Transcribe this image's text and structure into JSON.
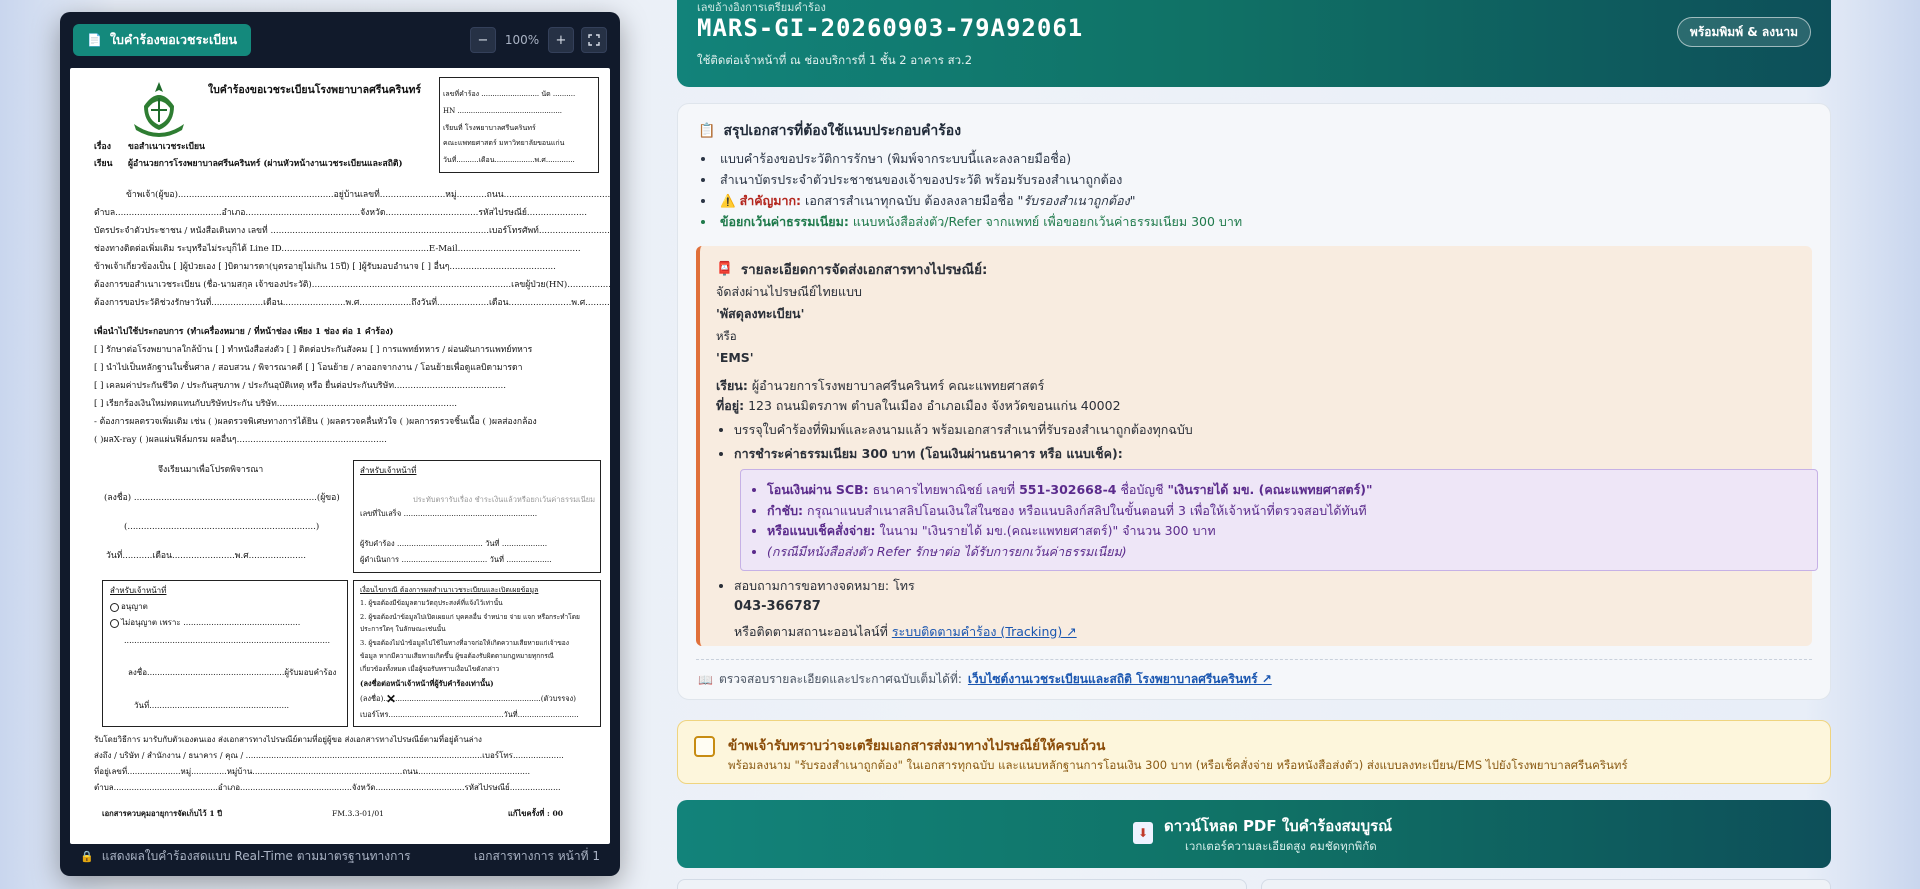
{
  "viewer": {
    "badge_label": "ใบคำร้องขอเวชระเบียน",
    "zoom_minus": "−",
    "zoom_value": "100%",
    "zoom_plus": "+",
    "fullscreen": "⛶",
    "footer_left": "แสดงผลใบคำร้องสดแบบ Real-Time ตามมาตรฐานทางการ",
    "footer_right": "เอกสารทางการ หน้าที่ 1"
  },
  "form": {
    "title": "ใบคำร้องขอเวชระเบียนโรงพยาบาลศรีนครินทร์",
    "subject_label": "เรื่อง",
    "subject": "ขอสำเนาเวชระเบียน",
    "to_label": "เรียน",
    "to": "ผู้อำนวยการโรงพยาบาลศรีนครินทร์ (ผ่านหัวหน้างานเวชระเบียนและสถิติ)",
    "box_line1": "เลขที่คำร้อง .......................... นัด ..........",
    "box_line2": "HN ...............................................",
    "box_line3": "เรียนที่  โรงพยาบาลศรีนครินทร์",
    "box_line4": "คณะแพทยศาสตร์ มหาวิทยาลัยขอนแก่น",
    "box_line5": "วันที่..........เดือน..................พ.ศ.............",
    "line1": "ข้าพเจ้า(ผู้ขอ).........................................................อยู่บ้านเลขที่........................หมู่...........ถนน.......................................",
    "line2": "ตำบล.......................................อำเภอ..........................................จังหวัด..................................รหัสไปรษณีย์......................",
    "line3": "บัตรประจำตัวประชาชน / หนังสือเดินทาง เลขที่ ................................................................................เบอร์โทรศัพท์..........................",
    "line4": "ช่องทางติดต่อเพิ่มเติม ระบุหรือไม่ระบุก็ได้ Line ID......................................................E-Mail.............................................",
    "line5": "ข้าพเจ้าเกี่ยวข้องเป็น [  ]ผู้ป่วยเอง [  ]บิดามารดา(บุตรอายุไม่เกิน 15ปี) [  ]ผู้รับมอบอำนาจ [  ] อื่นๆ.......................................",
    "line6": "ต้องการขอสำเนาเวชระเบียน (ชื่อ-นามสกุล เจ้าของประวัติ).........................................................................เลขผู้ป่วย(HN)......................",
    "line7": "ต้องการขอประวัติช่วงรักษาวันที่...................เดือน.......................พ.ศ...................ถึงวันที่...................เดือน.......................พ.ศ..................",
    "purpose_title": "เพื่อนำไปใช้ประกอบการ (ทำเครื่องหมาย /  ที่หน้าช่อง เพียง 1 ช่อง ต่อ 1 คำร้อง)",
    "purpose1": "[  ] รักษาต่อโรงพยาบาลใกล้บ้าน   [  ] ทำหนังสือส่งตัว   [  ] ติดต่อประกันสังคม   [  ] การแพทย์ทหาร / ผ่อนผันการแพทย์ทหาร",
    "purpose2": "[  ] นำไปเป็นหลักฐานในชั้นศาล / สอบสวน / พิจารณาคดี   [  ] โอนย้าย / ลาออกจากงาน / โอนย้ายเพื่อดูแลบิดามารดา",
    "purpose3": "[  ] เคลมค่าประกันชีวิต / ประกันสุขภาพ / ประกันอุบัติเหตุ หรือ ยื่นต่อประกันบริษัท.........................................",
    "purpose4": "[  ] เรียกร้องเงินใหม่ทดแทนกับบริษัทประกัน บริษัท..................................................................",
    "purpose5": " - ต้องการผลตรวจเพิ่มเติม เช่น (  )ผลตรวจพิเศษทางการได้ยิน (  )ผลตรวจคลื่นหัวใจ (  )ผลการตรวจชิ้นเนื้อ (  )ผลส่องกล้อง",
    "purpose6": "(  )ผลX-ray (  )ผลแผ่นฟิล์มกรม ผลอื่นๆ.......................................................",
    "sign_intro": "จึงเรียนมาเพื่อโปรดพิจารณา",
    "sign_name": "(ลงชื่อ) ...................................................................(ผู้ขอ)",
    "sign_paren": "(.....................................................................)",
    "sign_date": "วันที่...........เดือน.......................พ.ศ.....................",
    "staff_title": "สำหรับเจ้าหน้าที่",
    "staff_note": "ประทับตรารับเรื่อง  ชำระเงินแล้วหรือยกเว้นค่าธรรมเนียม",
    "staff_l1": "เลขที่ใบเสร็จ ........................................................",
    "staff_l2": "ผู้รับคำร้อง .................................... วันที่ ...................",
    "staff_l3": "ผู้ดำเนินการ .................................... วันที่ ...................",
    "officer_title": "สำหรับเจ้าหน้าที่",
    "officer_allow": "อนุญาต",
    "officer_deny": "ไม่อนุญาต เพราะ ..............................................",
    "officer_dots": ".................................................................................",
    "officer_sign": "ลงชื่อ......................................................ผู้รับมอบคำร้อง",
    "officer_date": "วันที่.......................................................",
    "delegate_title": "เงื่อนไขกรณี ต้องการผลสำเนาเวชระเบียนและเปิดเผยข้อมูล",
    "delegate1": "1. ผู้ขอต้องมีข้อมูลตามวัตถุประสงค์ที่แจ้งไว้เท่านั้น",
    "delegate2": "2. ผู้ขอต้องนำข้อมูลไปเปิดเผยแก่ บุคคลอื่น จำหน่าย จ่าย แจก หรือกระทำโดย",
    "delegate2b": "ประการใดๆ ในลักษณะเช่นนั้น",
    "delegate3": "3. ผู้ขอต้องไม่นำข้อมูลไปใช้ในทางที่อาจก่อให้เกิดความเสียหายแก่เจ้าของ",
    "delegate3b": "ข้อมูล หากมีความเสียหายเกิดขึ้น ผู้ขอต้องรับผิดตามกฎหมายทุกกรณี",
    "delegate3c": "เกี่ยวข้องทั้งหมด เมื่อผู้ขอรับทราบเงื่อนไขดังกล่าว",
    "delegate_sign_title": "(ลงชื่อต่อหน้าเจ้าหน้าที่ผู้รับคำร้องเท่านั้น)",
    "delegate_sign": "(ลงชื่อ)...................................................................(ตัวบรรจง)",
    "delegate_phone": "เบอร์โทร.................................................วันที่..........................",
    "receive_line": "รับโดยวิธีการ        มารับกับตัวเองตนเอง       ส่งเอกสารทางไปรษณีย์ตามที่อยู่ผู้ขอ        ส่งเอกสารทางไปรษณีย์ตามที่อยู่ด้านล่าง",
    "addr1": "ส่งถึง / บริษัท / สำนักงาน / ธนาคาร / คุณ / .............................................................................................เบอร์โทร....................",
    "addr2": "ที่อยู่เลขที่.....................หมู่..............หมู่บ้าน...........................................................ถนน............................................",
    "addr3": "ตำบล.........................................อำเภอ............................................จังหวัด...................................รหัสไปรษณีย์....................",
    "footer_left": "เอกสารควบคุมอายุการจัดเก็บไว้ 1 ปี",
    "footer_mid": "FM.3.3-01/01",
    "footer_right": "แก้ไขครั้งที่ : 00"
  },
  "hero": {
    "top_label": "เลขอ้างอิงการเตรียมคำร้อง",
    "ref_code": "MARS-GI-20260903-79A92061",
    "location": "ใช้ติดต่อเจ้าหน้าที่ ณ ช่องบริการที่ 1 ชั้น 2 อาคาร สว.2",
    "print_button": "พร้อมพิมพ์ & ลงนาม"
  },
  "summary": {
    "title": "สรุปเอกสารที่ต้องใช้แนบประกอบคำร้อง",
    "item1": "แบบคำร้องขอประวัติการรักษา (พิมพ์จากระบบนี้และลงลายมือชื่อ)",
    "item2": "สำเนาบัตรประจำตัวประชาชนของเจ้าของประวัติ พร้อมรับรองสำเนาถูกต้อง",
    "item3_label": "สำคัญมาก:",
    "item3_text": "เอกสารสำเนาทุกฉบับ ต้องลงลายมือชื่อ",
    "item3_quote": "\"รับรองสำเนาถูกต้อง\"",
    "item4_label": "ข้อยกเว้นค่าธรรมเนียม:",
    "item4_text": "แนบหนังสือส่งตัว/Refer จากแพทย์ เพื่อขอยกเว้นค่าธรรมเนียม 300 บาท"
  },
  "postal": {
    "title": "รายละเอียดการจัดส่งเอกสารทางไปรษณีย์:",
    "via": "จัดส่งผ่านไปรษณีย์ไทยแบบ",
    "option1": "'พัสดุลงทะเบียน'",
    "or": "หรือ",
    "option2": "'EMS'",
    "to_label": "เรียน:",
    "to_text": "ผู้อำนวยการโรงพยาบาลศรีนครินทร์ คณะแพทยศาสตร์",
    "addr_label": "ที่อยู่:",
    "addr_text": "123 ถนนมิตรภาพ ตำบลในเมือง อำเภอเมือง จังหวัดขอนแก่น 40002",
    "bullet1": "บรรจุใบคำร้องที่พิมพ์และลงนามแล้ว พร้อมเอกสารสำเนาที่รับรองสำเนาถูกต้องทุกฉบับ",
    "bullet2": "การชำระค่าธรรมเนียม 300 บาท (โอนเงินผ่านธนาคาร หรือ แนบเช็ค):",
    "pay1_label": "โอนเงินผ่าน SCB:",
    "pay1_text": "ธนาคารไทยพาณิชย์ เลขที่",
    "pay1_acct": "551-302668-4",
    "pay1_name_label": "ชื่อบัญชี",
    "pay1_name": "\"เงินรายได้ มข. (คณะแพทยศาสตร์)\"",
    "pay2_label": "กำชับ:",
    "pay2_text": "กรุณาแนบสำเนาสลิปโอนเงินใส่ในซอง หรือแนบลิงก์สลิปในขั้นตอนที่ 3 เพื่อให้เจ้าหน้าที่ตรวจสอบได้ทันที",
    "pay3_label": "หรือแนบเช็คสั่งจ่าย:",
    "pay3_text": "ในนาม \"เงินรายได้ มข.(คณะแพทยศาสตร์)\" จำนวน 300 บาท",
    "pay4_text": "(กรณีมีหนังสือส่งตัว Refer รักษาต่อ ได้รับการยกเว้นค่าธรรมเนียม)",
    "contact": "สอบถามการขอทางจดหมาย: โทร",
    "phone": "043-366787",
    "track_text": "หรือติดตามสถานะออนไลน์ที่",
    "track_link": "ระบบติดตามคำร้อง (Tracking) ↗"
  },
  "more_info": {
    "text": "ตรวจสอบรายละเอียดและประกาศฉบับเต็มได้ที่:",
    "link": "เว็บไซต์งานเวชระเบียนและสถิติ โรงพยาบาลศรีนครินทร์ ↗"
  },
  "ack": {
    "title": "ข้าพเจ้ารับทราบว่าจะเตรียมเอกสารส่งมาทางไปรษณีย์ให้ครบถ้วน",
    "detail": "พร้อมลงนาม \"รับรองสำเนาถูกต้อง\" ในเอกสารทุกฉบับ และแนบหลักฐานการโอนเงิน 300 บาท (หรือเช็คสั่งจ่าย หรือหนังสือส่งตัว) ส่งแบบลงทะเบียน/EMS ไปยังโรงพยาบาลศรีนครินทร์"
  },
  "download": {
    "label": "ดาวน์โหลด PDF ใบคำร้องสมบูรณ์",
    "sub": "เวกเตอร์ความละเอียดสูง คมชัดทุกพิกัด"
  },
  "colors": {
    "teal": "#12837a",
    "dark_teal": "#0d4f59",
    "warning_orange": "#e0703a",
    "purple": "#5b2b8c",
    "ack_yellow": "#fdf6dc"
  }
}
